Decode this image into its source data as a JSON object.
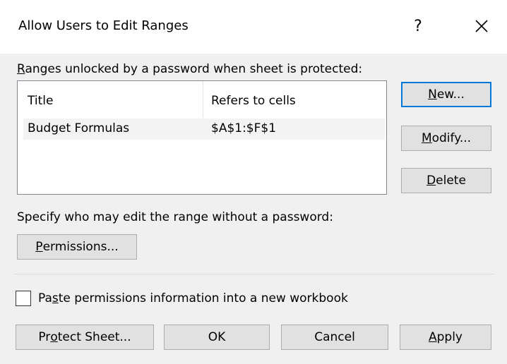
{
  "dialog": {
    "title": "Allow Users to Edit Ranges",
    "help_glyph": "?",
    "close_icon": "close-icon"
  },
  "ranges": {
    "label_mnemonic": "R",
    "label_rest": "anges unlocked by a password when sheet is protected:",
    "columns": {
      "title": "Title",
      "refers_to": "Refers to cells"
    },
    "rows": [
      {
        "title": "Budget Formulas",
        "refers_to": "$A$1:$F$1"
      }
    ]
  },
  "side_buttons": {
    "new": {
      "mnemonic": "N",
      "rest": "ew..."
    },
    "modify": {
      "mnemonic": "M",
      "rest": "odify..."
    },
    "delete": {
      "mnemonic": "D",
      "rest": "elete"
    }
  },
  "permissions": {
    "label": "Specify who may edit the range without a password:",
    "button": {
      "mnemonic": "P",
      "rest": "ermissions..."
    }
  },
  "paste_option": {
    "pre": "Pa",
    "mnemonic": "s",
    "post": "te permissions information into a new workbook",
    "checked": false
  },
  "bottom_buttons": {
    "protect_sheet": {
      "pre": "Pr",
      "mnemonic": "o",
      "post": "tect Sheet..."
    },
    "ok": "OK",
    "cancel": "Cancel",
    "apply": {
      "mnemonic": "A",
      "rest": "pply"
    }
  },
  "colors": {
    "accent": "#0078d7",
    "dialog_bg": "#f0f0f0",
    "button_bg": "#e1e1e1"
  }
}
